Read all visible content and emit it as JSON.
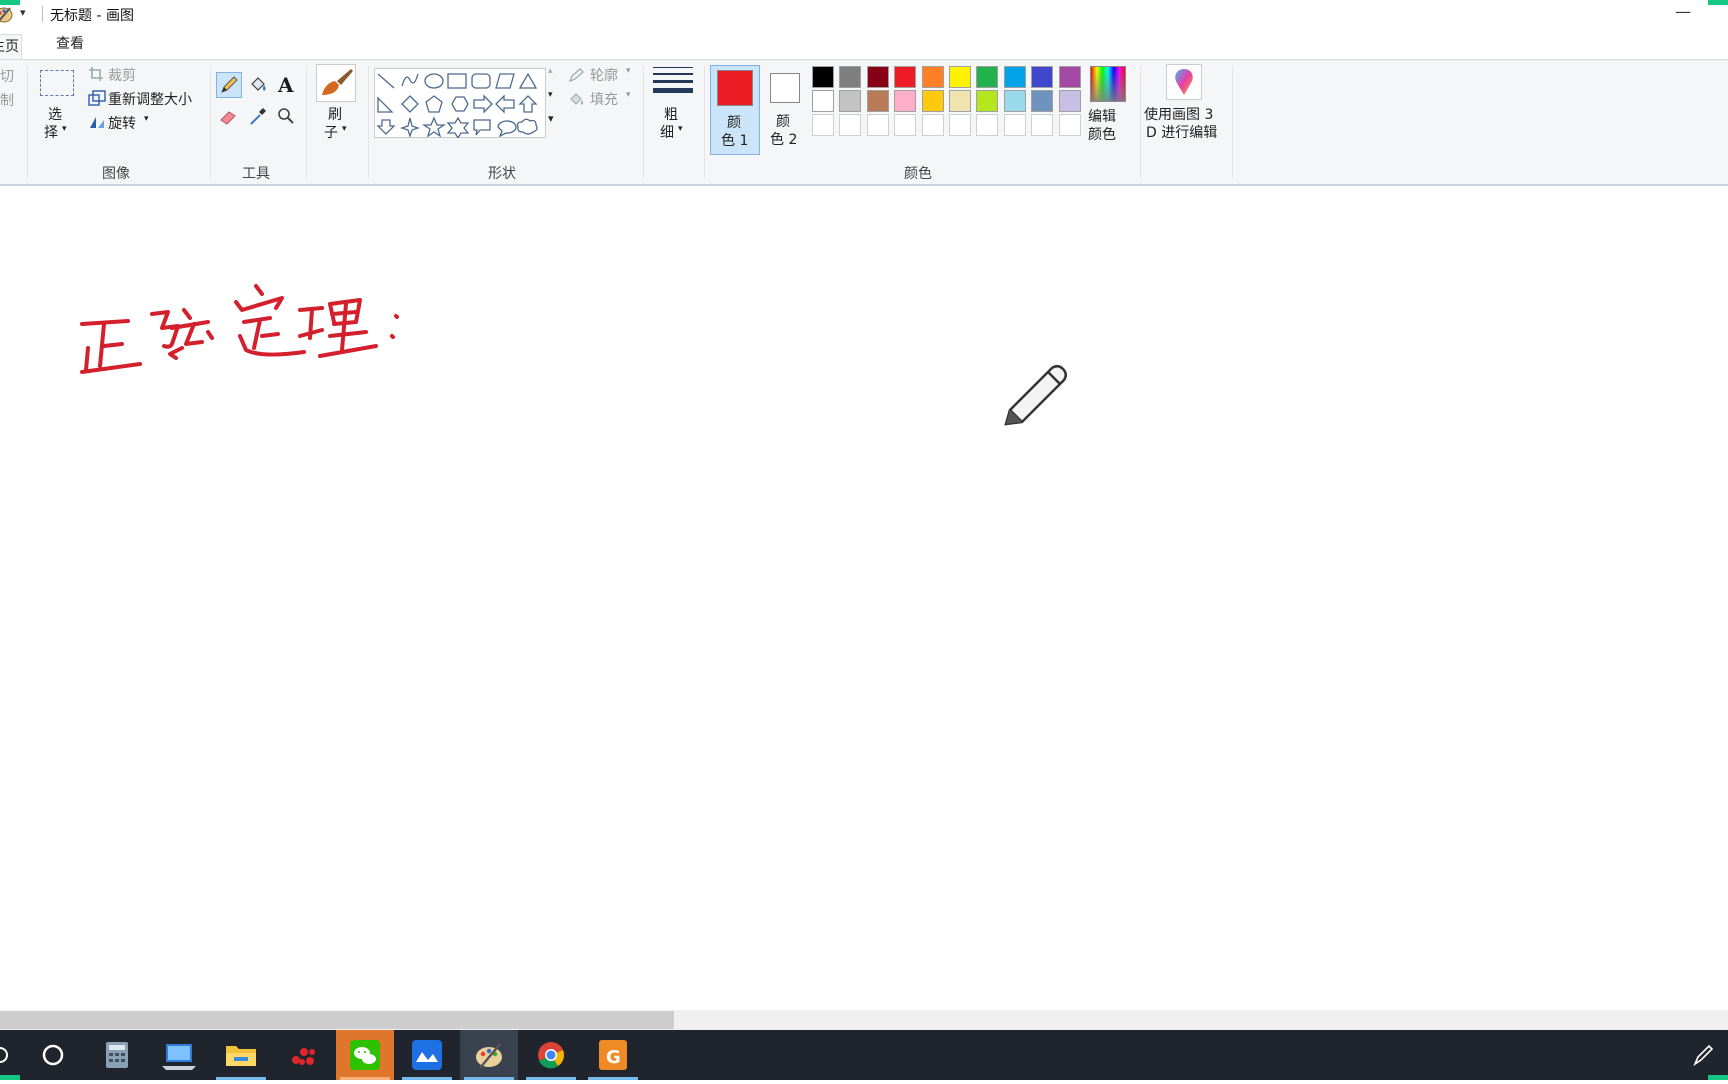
{
  "window": {
    "title": "无标题 - 画图",
    "minimize_glyph": "—"
  },
  "tabs": [
    {
      "label": "主页"
    },
    {
      "label": "查看"
    }
  ],
  "ribbon": {
    "clipboard": {
      "cut": "剪切",
      "copy": "复制"
    },
    "image": {
      "select_label": "选择",
      "select_line1": "选",
      "select_line2": "择",
      "crop": "裁剪",
      "resize": "重新调整大小",
      "rotate": "旋转",
      "group_label": "图像"
    },
    "tools": {
      "group_label": "工具"
    },
    "brush": {
      "line1": "刷",
      "line2": "子"
    },
    "shapes": {
      "outline": "轮廓",
      "fill": "填充",
      "group_label": "形状"
    },
    "size": {
      "line1": "粗",
      "line2": "细"
    },
    "colors": {
      "color1_line1": "颜",
      "color1_line2": "色 1",
      "color2_line1": "颜",
      "color2_line2": "色 2",
      "edit_line1": "编辑",
      "edit_line2": "颜色",
      "paint3d_line1": "使用画图 3",
      "paint3d_line2": "D 进行编辑",
      "group_label": "颜色",
      "color1_value": "#ed1c24",
      "color2_value": "#ffffff",
      "palette_row1": [
        "#000000",
        "#7f7f7f",
        "#880015",
        "#ed1c24",
        "#ff7f27",
        "#fff200",
        "#22b14c",
        "#00a2e8",
        "#3f48cc",
        "#a349a4"
      ],
      "palette_row2": [
        "#ffffff",
        "#c3c3c3",
        "#b97a57",
        "#ffaec9",
        "#ffc90e",
        "#efe4b0",
        "#b5e61d",
        "#99d9ea",
        "#7092be",
        "#c8bfe7"
      ],
      "palette_row3": [
        "#ffffff",
        "#ffffff",
        "#ffffff",
        "#ffffff",
        "#ffffff",
        "#ffffff",
        "#ffffff",
        "#ffffff",
        "#ffffff",
        "#ffffff"
      ]
    }
  },
  "canvas": {
    "handwriting": "正弦定理:",
    "ink_color": "#d4202c"
  }
}
